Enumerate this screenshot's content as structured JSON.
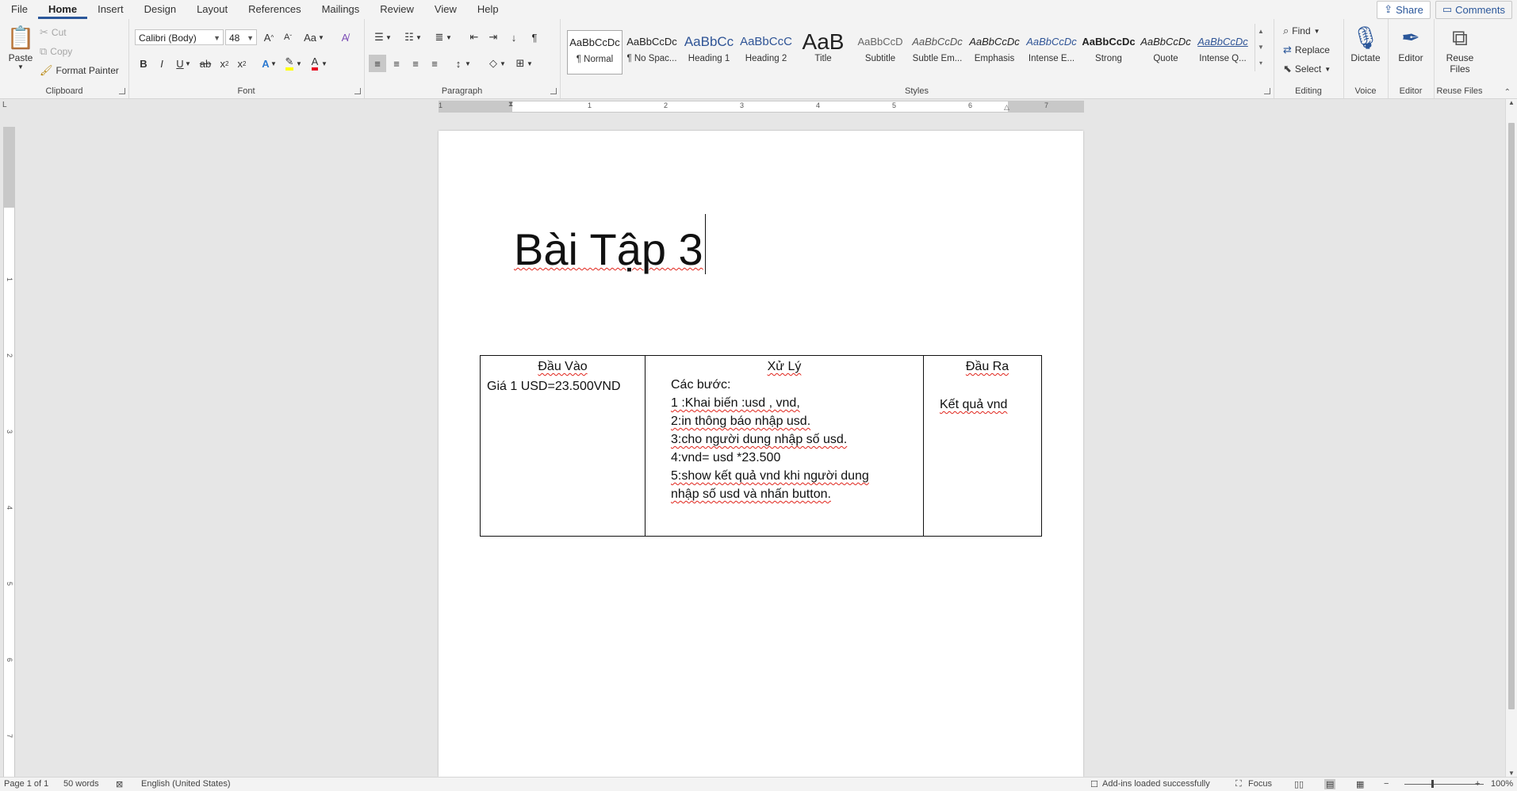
{
  "menu": {
    "tabs": [
      "File",
      "Home",
      "Insert",
      "Design",
      "Layout",
      "References",
      "Mailings",
      "Review",
      "View",
      "Help"
    ],
    "active_tab": "Home",
    "share": "Share",
    "comments": "Comments"
  },
  "ribbon": {
    "clipboard": {
      "label": "Clipboard",
      "paste": "Paste",
      "cut": "Cut",
      "copy": "Copy",
      "format_painter": "Format Painter"
    },
    "font": {
      "label": "Font",
      "font_name": "Calibri (Body)",
      "font_size": "48",
      "change_case": "Aa"
    },
    "paragraph": {
      "label": "Paragraph"
    },
    "styles": {
      "label": "Styles",
      "items": [
        {
          "preview": "AaBbCcDc",
          "name": "¶ Normal"
        },
        {
          "preview": "AaBbCcDc",
          "name": "¶ No Spac..."
        },
        {
          "preview": "AaBbCc",
          "name": "Heading 1"
        },
        {
          "preview": "AaBbCcC",
          "name": "Heading 2"
        },
        {
          "preview": "AaB",
          "name": "Title"
        },
        {
          "preview": "AaBbCcD",
          "name": "Subtitle"
        },
        {
          "preview": "AaBbCcDc",
          "name": "Subtle Em..."
        },
        {
          "preview": "AaBbCcDc",
          "name": "Emphasis"
        },
        {
          "preview": "AaBbCcDc",
          "name": "Intense E..."
        },
        {
          "preview": "AaBbCcDc",
          "name": "Strong"
        },
        {
          "preview": "AaBbCcDc",
          "name": "Quote"
        },
        {
          "preview": "AaBbCcDc",
          "name": "Intense Q..."
        }
      ]
    },
    "editing": {
      "label": "Editing",
      "find": "Find",
      "replace": "Replace",
      "select": "Select"
    },
    "voice": {
      "label": "Voice",
      "dictate": "Dictate"
    },
    "editor": {
      "label": "Editor",
      "editor": "Editor"
    },
    "reuse": {
      "label": "Reuse Files",
      "reuse_line1": "Reuse",
      "reuse_line2": "Files"
    }
  },
  "ruler": {
    "h_numbers": [
      "1",
      "1",
      "2",
      "3",
      "4",
      "5",
      "6",
      "7"
    ],
    "v_numbers": [
      "1",
      "2",
      "3",
      "4",
      "5",
      "6",
      "7"
    ]
  },
  "document": {
    "title": "Bài Tập 3",
    "table": {
      "headers": [
        "Đầu Vào",
        "Xử Lý",
        "Đầu Ra"
      ],
      "input": "Giá 1 USD=23.500VND",
      "process_lines": [
        "Các bước:",
        "1 :Khai biến :usd , vnd,",
        "2:in thông báo nhập usd.",
        "3:cho người dung nhập số usd.",
        "4:vnd= usd *23.500",
        "5:show kết quả vnd khi người dung",
        "nhập số usd và nhấn button."
      ],
      "output": "Kết quả vnd"
    }
  },
  "statusbar": {
    "page": "Page 1 of 1",
    "words": "50 words",
    "language": "English (United States)",
    "addins": "Add-ins loaded successfully",
    "focus": "Focus",
    "zoom": "100%"
  },
  "colors": {
    "accent": "#2b579a",
    "spell_error": "#e0241b",
    "font_color": "#e81123",
    "highlight": "#ffff00"
  }
}
